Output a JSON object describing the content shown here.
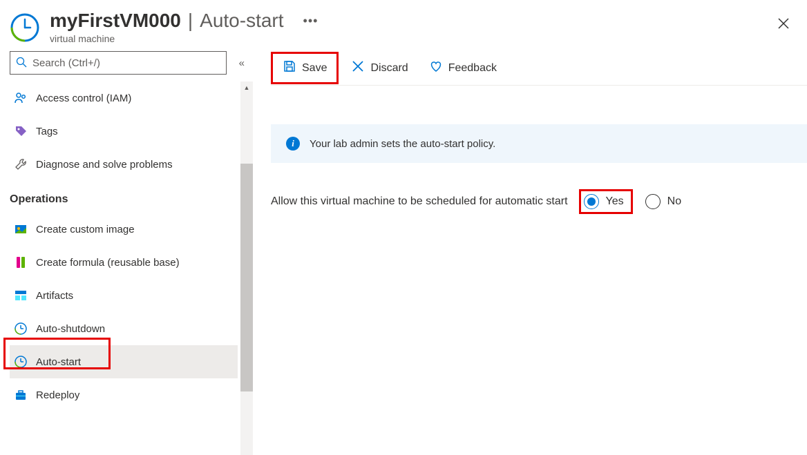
{
  "header": {
    "resource_name": "myFirstVM000",
    "section": "Auto-start",
    "subtitle": "virtual machine"
  },
  "sidebar": {
    "search_placeholder": "Search (Ctrl+/)",
    "items_top": [
      {
        "label": "Access control (IAM)"
      },
      {
        "label": "Tags"
      },
      {
        "label": "Diagnose and solve problems"
      }
    ],
    "group_label": "Operations",
    "items_ops": [
      {
        "label": "Create custom image"
      },
      {
        "label": "Create formula (reusable base)"
      },
      {
        "label": "Artifacts"
      },
      {
        "label": "Auto-shutdown"
      },
      {
        "label": "Auto-start"
      },
      {
        "label": "Redeploy"
      }
    ]
  },
  "toolbar": {
    "save": "Save",
    "discard": "Discard",
    "feedback": "Feedback"
  },
  "content": {
    "info_message": "Your lab admin sets the auto-start policy.",
    "setting_label": "Allow this virtual machine to be scheduled for automatic start",
    "option_yes": "Yes",
    "option_no": "No",
    "selected": "yes"
  }
}
